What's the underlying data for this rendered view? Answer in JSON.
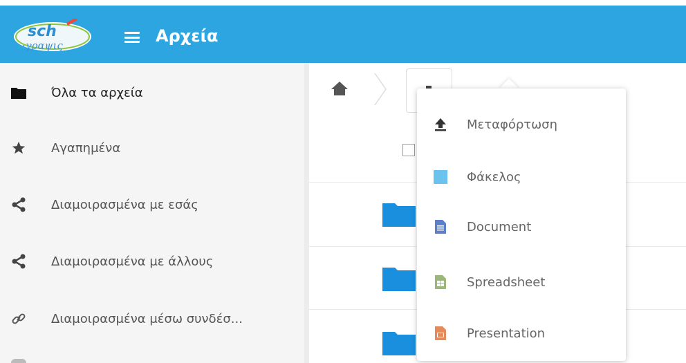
{
  "header": {
    "logo_text": "sch γραψις",
    "title": "Αρχεία",
    "color": "#2da5e0"
  },
  "sidebar": {
    "items": [
      {
        "label": "Όλα τα αρχεία",
        "icon": "folder-icon",
        "active": true
      },
      {
        "label": "Αγαπημένα",
        "icon": "star-icon"
      },
      {
        "label": "Διαμοιρασμένα με εσάς",
        "icon": "share-icon"
      },
      {
        "label": "Διαμοιρασμένα με άλλους",
        "icon": "share-icon"
      },
      {
        "label": "Διαμοιρασμένα μέσω συνδέσ...",
        "icon": "link-icon"
      }
    ]
  },
  "menu": {
    "items": [
      {
        "label": "Μεταφόρτωση",
        "icon": "upload-icon"
      },
      {
        "label": "Φάκελος",
        "icon": "folder-icon"
      },
      {
        "label": "Document",
        "icon": "document-icon"
      },
      {
        "label": "Spreadsheet",
        "icon": "spreadsheet-icon"
      },
      {
        "label": "Presentation",
        "icon": "presentation-icon"
      }
    ]
  }
}
